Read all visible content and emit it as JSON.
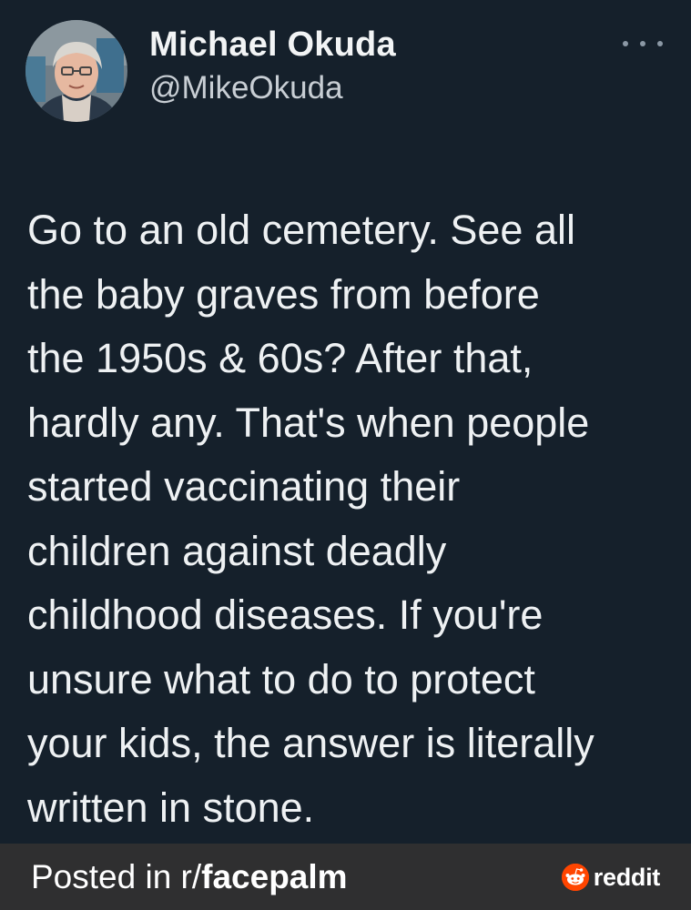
{
  "tweet": {
    "display_name": "Michael Okuda",
    "handle": "@MikeOkuda",
    "more_icon": "ellipsis-icon",
    "text": "Go to an old cemetery. See all\nthe baby graves from before\nthe 1950s & 60s? After that,\nhardly any. That's when people\nstarted vaccinating their\nchildren against deadly\nchildhood diseases. If you're\nunsure what to do to protect\nyour kids, the answer is literally\nwritten in stone."
  },
  "footer": {
    "posted_prefix": "Posted in r/",
    "subreddit": "facepalm",
    "brand": "reddit",
    "brand_color": "#ff4500"
  },
  "colors": {
    "background": "#15202b",
    "footer_background": "#2f2f30"
  }
}
